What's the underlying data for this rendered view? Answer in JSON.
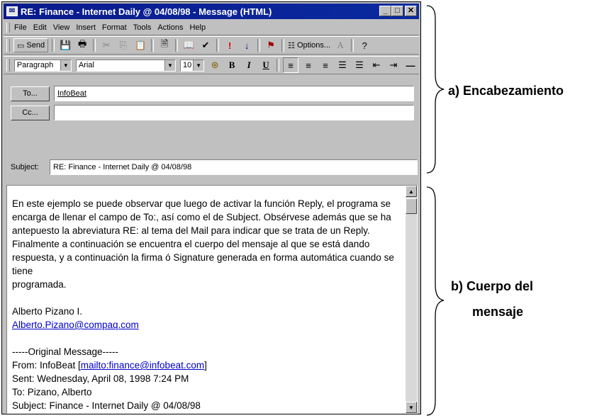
{
  "window": {
    "title": "RE: Finance - Internet Daily @ 04/08/98 - Message (HTML)",
    "title_icon": "envelope-icon",
    "controls": [
      "minimize",
      "maximize",
      "close"
    ]
  },
  "menu": [
    "File",
    "Edit",
    "View",
    "Insert",
    "Format",
    "Tools",
    "Actions",
    "Help"
  ],
  "toolbar": {
    "send_label": "Send",
    "options_label": "Options...",
    "icons": [
      "save-icon",
      "print-icon",
      "cut-icon",
      "copy-icon",
      "paste-icon",
      "insert-file-icon",
      "address-book-icon",
      "check-names-icon",
      "importance-high-icon",
      "importance-low-icon",
      "flag-icon",
      "options-icon",
      "font-icon",
      "help-icon"
    ]
  },
  "format_bar": {
    "style": "Paragraph",
    "font": "Arial",
    "size": "10",
    "buttons": [
      "B",
      "I",
      "U"
    ]
  },
  "fields": {
    "to_button": "To...",
    "to_value": "InfoBeat",
    "cc_button": "Cc...",
    "cc_value": "",
    "subject_label": "Subject:",
    "subject_value": "RE: Finance - Internet Daily @ 04/08/98"
  },
  "body": {
    "paragraph_lines": [
      "En este ejemplo se puede observar que luego de activar la función Reply, el programa se",
      "encarga de llenar el campo de To:, así como el de Subject. Obsérvese además que se ha",
      "antepuesto la abreviatura RE: al tema del Mail para indicar que se trata de un Reply.",
      "Finalmente a continuación se encuentra el cuerpo del mensaje al que se está dando",
      "respuesta, y a continuación la firma ó Signature generada en forma automática cuando se tiene",
      "programada."
    ],
    "sig_name": "Alberto Pizano I.",
    "sig_email": "Alberto.Pizano@compaq.com",
    "original_header": "-----Original Message-----",
    "from_prefix": "From: InfoBeat [",
    "from_link": "mailto:finance@infobeat.com",
    "from_suffix": "]",
    "sent": "Sent: Wednesday, April 08, 1998 7:24 PM",
    "to": "To: Pizano, Alberto",
    "subject": "Subject: Finance - Internet Daily @ 04/08/98"
  },
  "annotations": {
    "header_label": "a) Encabezamiento",
    "body_label_1": "b) Cuerpo del",
    "body_label_2": "mensaje"
  },
  "colors": {
    "titlebar": "#0a1a8c",
    "chrome": "#c0c0c0",
    "link": "#0000cc",
    "importance_high": "#e00000",
    "importance_low": "#0000c0"
  }
}
